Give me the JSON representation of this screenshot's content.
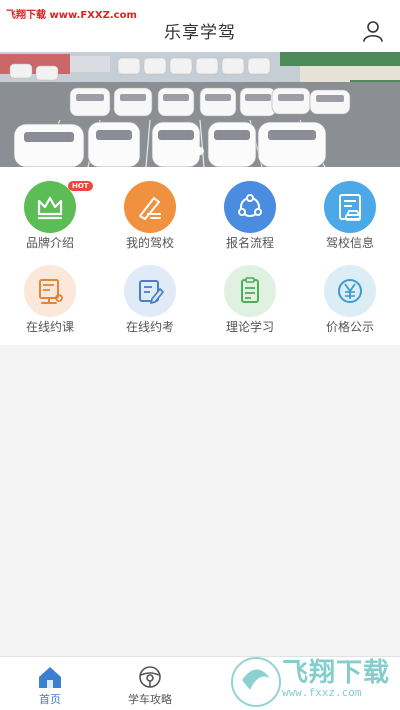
{
  "header": {
    "title": "乐享学驾",
    "watermark": "飞翔下载 www.FXXZ.com"
  },
  "banner": {
    "alt": "driving school parking lot photo"
  },
  "grid": {
    "items": [
      {
        "label": "品牌介绍",
        "icon": "crown-icon",
        "color": "#5cbd55",
        "badge": "HOT"
      },
      {
        "label": "我的驾校",
        "icon": "pen-icon",
        "color": "#f0913f"
      },
      {
        "label": "报名流程",
        "icon": "share-icon",
        "color": "#4a8de0"
      },
      {
        "label": "驾校信息",
        "icon": "car-document-icon",
        "color": "#4da8e8"
      },
      {
        "label": "在线约课",
        "icon": "monitor-icon",
        "color": "#fbe8da"
      },
      {
        "label": "在线约考",
        "icon": "edit-icon",
        "color": "#e0ebf7"
      },
      {
        "label": "理论学习",
        "icon": "checklist-icon",
        "color": "#e0f1e2"
      },
      {
        "label": "价格公示",
        "icon": "yen-icon",
        "color": "#dcedf6"
      }
    ]
  },
  "tabbar": {
    "items": [
      {
        "label": "首页",
        "icon": "home-icon",
        "active": true
      },
      {
        "label": "学车攻略",
        "icon": "steering-wheel-icon",
        "active": false
      },
      {
        "label": "",
        "icon": "",
        "active": false
      },
      {
        "label": "",
        "icon": "",
        "active": false
      }
    ]
  },
  "watermark_bottom": {
    "brand": "飞翔下载",
    "url": "www.fxxz.com"
  },
  "colors": {
    "accent": "#3a7fd0",
    "hot": "#e84a3a"
  }
}
